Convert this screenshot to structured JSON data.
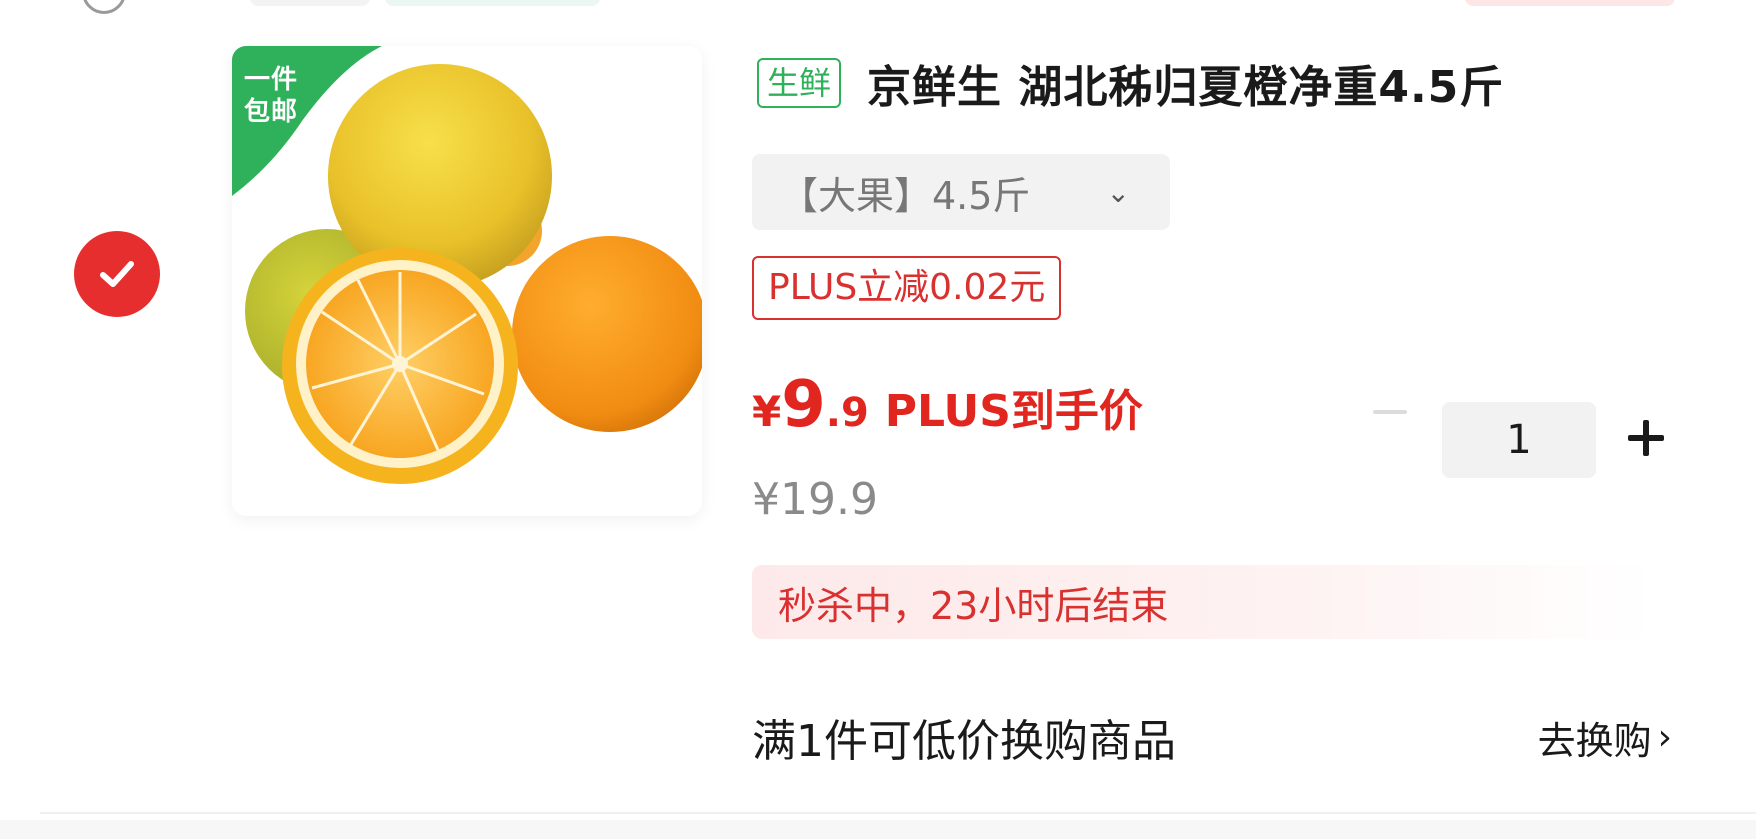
{
  "colors": {
    "accent_red": "#e0261f",
    "fresh_green": "#2fb05a",
    "muted_gray": "#8a8a8a"
  },
  "item": {
    "selected": true,
    "thumbnail_badge": "一件\n包邮",
    "fresh_tag": "生鲜",
    "title": "京鲜生 湖北秭归夏橙净重4.5斤",
    "spec": "【大果】4.5斤",
    "plus_discount": "PLUS立减0.02元",
    "price": {
      "currency": "¥",
      "integer": "9",
      "decimal": ".9",
      "label": "PLUS到手价"
    },
    "original_price": "¥19.9",
    "quantity": "1",
    "flash_sale": "秒杀中，23小时后结束",
    "exchange": {
      "text": "满1件可低价换购商品",
      "action": "去换购",
      "arrow": "›"
    }
  },
  "icons": {
    "check": "check-icon",
    "chevron": "chevron-down-icon",
    "minus": "minus-icon",
    "plus": "plus-icon"
  }
}
